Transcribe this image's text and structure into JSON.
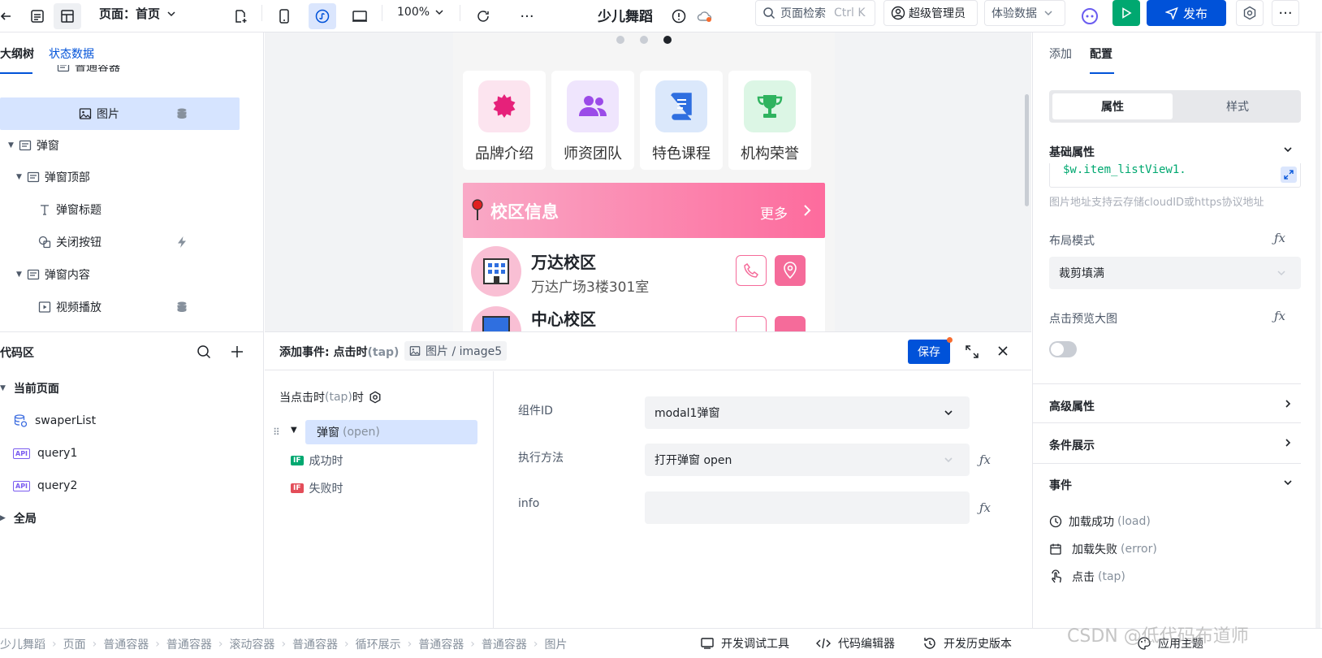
{
  "topbar": {
    "page_selector": "页面：首页",
    "zoom": "100%",
    "app_name": "少儿舞蹈",
    "search_label": "页面检索",
    "search_shortcut": "Ctrl K",
    "user_label": "超级管理员",
    "data_mode": "体验数据",
    "publish_label": "发布"
  },
  "left": {
    "tabs": [
      "大纲树",
      "状态数据"
    ],
    "tree": [
      {
        "label": "普通容器",
        "icon": "container-icon"
      },
      {
        "label": "图片",
        "icon": "image-icon",
        "selected": true,
        "badge": "database-icon"
      },
      {
        "label": "弹窗",
        "icon": "container-icon"
      },
      {
        "label": "弹窗顶部",
        "icon": "container-icon"
      },
      {
        "label": "弹窗标题",
        "icon": "text-icon"
      },
      {
        "label": "关闭按钮",
        "icon": "button-icon",
        "badge": "lightning-icon"
      },
      {
        "label": "弹窗内容",
        "icon": "container-icon"
      },
      {
        "label": "视频播放",
        "icon": "video-icon",
        "badge": "database-icon"
      }
    ],
    "code_title": "代码区",
    "code_groups": {
      "current": "当前页面",
      "items": [
        "swaperList",
        "query1",
        "query2"
      ],
      "global": "全局"
    }
  },
  "phone": {
    "grid": [
      {
        "label": "品牌介绍",
        "color": "#fce4ef",
        "iconColor": "#e6217a",
        "icon": "badge-icon"
      },
      {
        "label": "师资团队",
        "color": "#efe5fd",
        "iconColor": "#9b4be8",
        "icon": "team-icon"
      },
      {
        "label": "特色课程",
        "color": "#dbe8fb",
        "iconColor": "#2f6fe0",
        "icon": "book-icon"
      },
      {
        "label": "机构荣誉",
        "color": "#dcf6e5",
        "iconColor": "#2fb35f",
        "icon": "trophy-icon"
      }
    ],
    "campus_header": "校区信息",
    "more": "更多",
    "campuses": [
      {
        "name": "万达校区",
        "addr": "万达广场3楼301室"
      },
      {
        "name": "中心校区",
        "addr": ""
      }
    ]
  },
  "event": {
    "title": "添加事件: 点击时",
    "title_tag": "(tap)",
    "target": "图片 / image5",
    "save": "保存",
    "trigger": "当点击时",
    "trigger_tag": "(tap)",
    "trigger_suffix": "时",
    "action": "弹窗",
    "action_tag": "(open)",
    "success": "成功时",
    "fail": "失败时",
    "fields": {
      "component_label": "组件ID",
      "component_value": "modal1弹窗",
      "method_label": "执行方法",
      "method_value": "打开弹窗 open",
      "info_label": "info",
      "info_value": ""
    }
  },
  "right": {
    "tabs": [
      "添加",
      "配置"
    ],
    "seg": [
      "属性",
      "样式"
    ],
    "basic": "基础属性",
    "code_value": "$w.item_listView1.",
    "hint": "图片地址支持云存储cloudID或https协议地址",
    "layout_label": "布局模式",
    "layout_value": "裁剪填满",
    "preview_label": "点击预览大图",
    "advanced": "高级属性",
    "condition": "条件展示",
    "events": "事件",
    "event_items": [
      {
        "label": "加载成功",
        "tag": "(load)"
      },
      {
        "label": "加载失败",
        "tag": "(error)"
      },
      {
        "label": "点击",
        "tag": "(tap)"
      }
    ]
  },
  "bottom": {
    "crumbs": [
      "少儿舞蹈",
      "页面",
      "普通容器",
      "普通容器",
      "滚动容器",
      "普通容器",
      "循环展示",
      "普通容器",
      "普通容器",
      "图片"
    ],
    "tools": [
      "开发调试工具",
      "代码编辑器",
      "开发历史版本",
      "应用主题"
    ],
    "watermark": "CSDN @低代码布道师"
  },
  "colors": {
    "primary": "#0052d9",
    "green": "#00a870",
    "selected": "#d6e4ff"
  }
}
